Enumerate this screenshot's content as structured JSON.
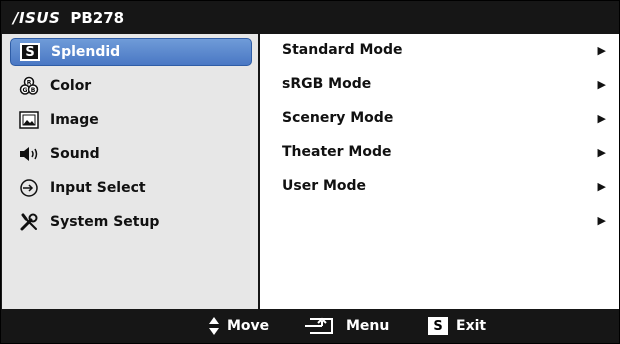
{
  "title": {
    "brand": "/ISUS",
    "model": "PB278"
  },
  "menu": [
    {
      "label": "Splendid",
      "icon": "splendid-s-icon",
      "active": true
    },
    {
      "label": "Color",
      "icon": "color-rgb-icon",
      "active": false
    },
    {
      "label": "Image",
      "icon": "image-icon",
      "active": false
    },
    {
      "label": "Sound",
      "icon": "speaker-icon",
      "active": false
    },
    {
      "label": "Input Select",
      "icon": "input-select-icon",
      "active": false
    },
    {
      "label": "System Setup",
      "icon": "wrench-screwdriver-icon",
      "active": false
    }
  ],
  "submenu": [
    {
      "label": "Standard Mode",
      "arrow": "▶"
    },
    {
      "label": "sRGB Mode",
      "arrow": "▶"
    },
    {
      "label": "Scenery Mode",
      "arrow": "▶"
    },
    {
      "label": "Theater Mode",
      "arrow": "▶"
    },
    {
      "label": "User Mode",
      "arrow": "▶"
    },
    {
      "label": "",
      "arrow": "▶"
    }
  ],
  "footer": {
    "move": "Move",
    "menu": "Menu",
    "exit": "Exit",
    "exit_key": "S"
  },
  "splendid_key": "S",
  "colors": {
    "accent": "#5a86cc",
    "panel_bg": "#e7e7e7",
    "bar_bg": "#161616"
  }
}
